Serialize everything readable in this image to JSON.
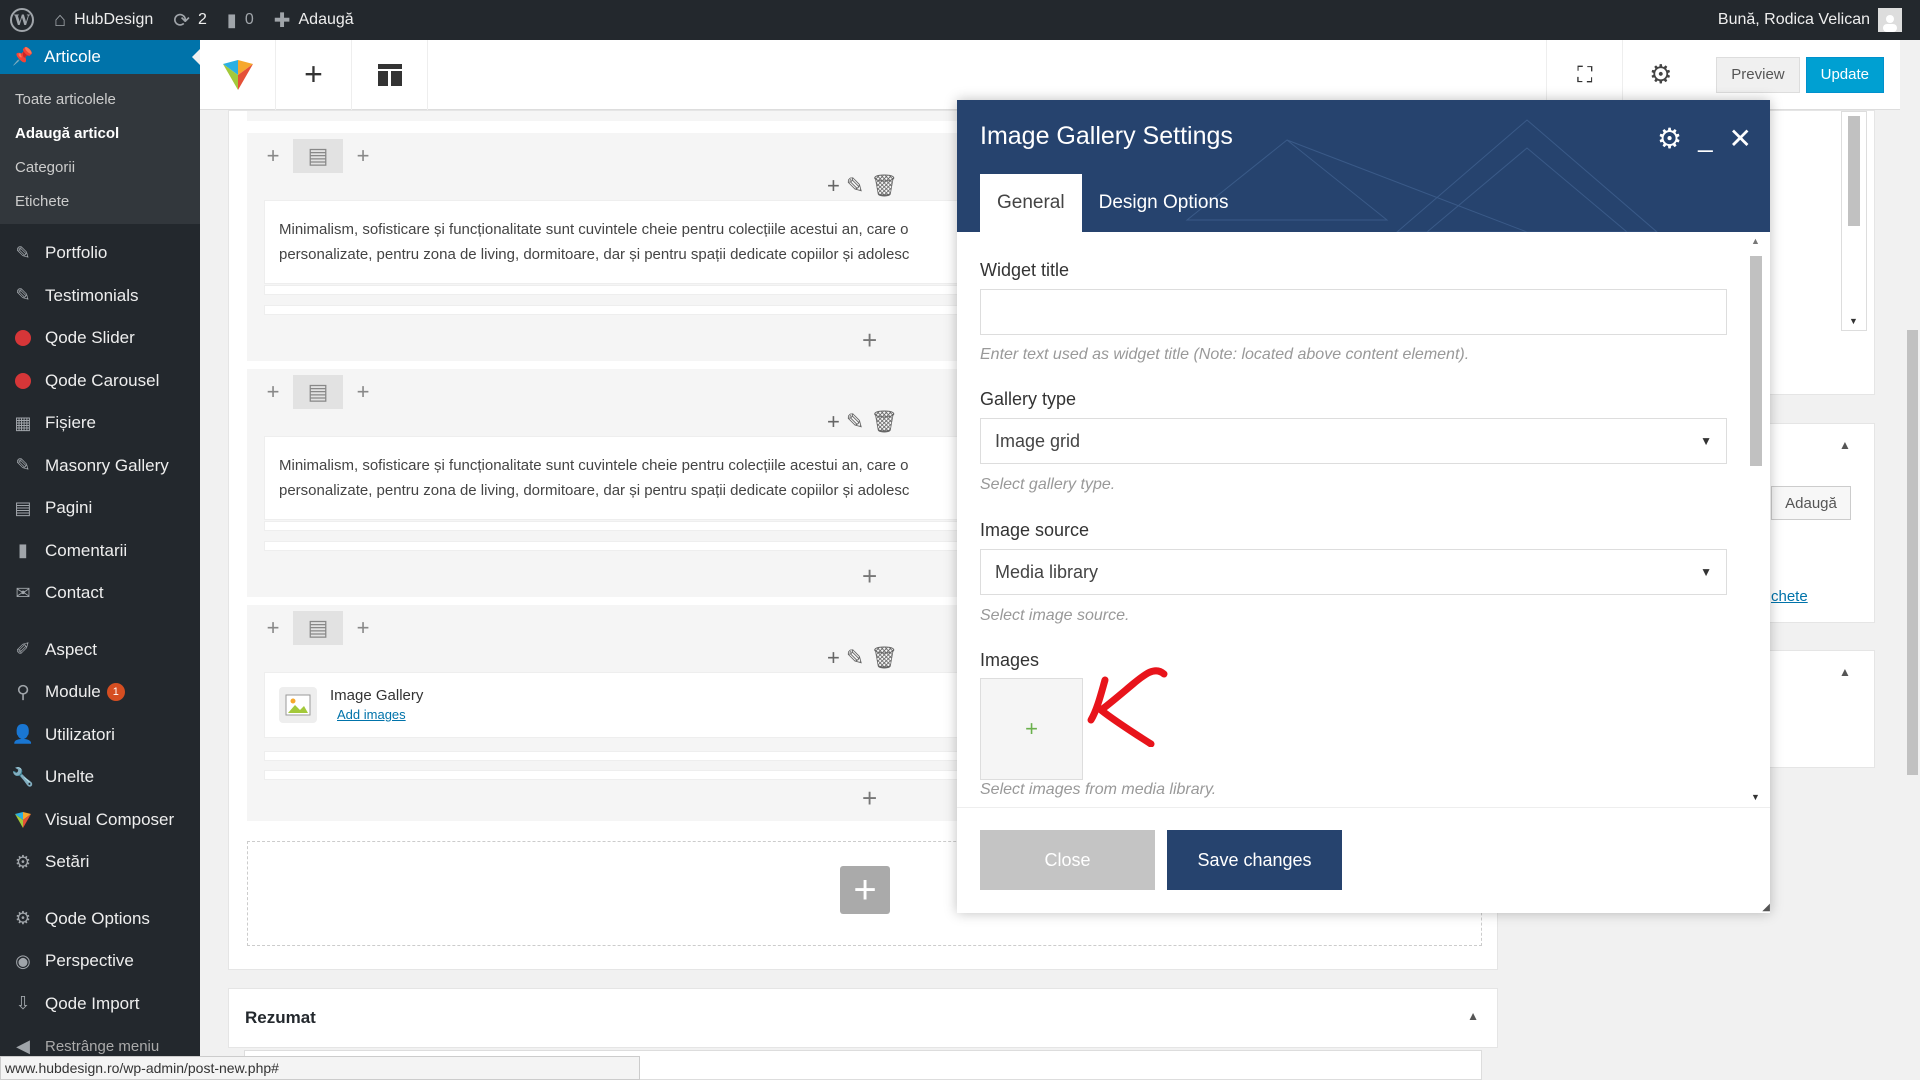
{
  "adminbar": {
    "site_name": "HubDesign",
    "updates_count": "2",
    "comments_count": "0",
    "new_label": "Adaugă",
    "greeting": "Bună, Rodica Velican"
  },
  "sidebar": {
    "current": "Articole",
    "submenu": [
      "Toate articolele",
      "Adaugă articol",
      "Categorii",
      "Etichete"
    ],
    "group1": [
      "Portfolio",
      "Testimonials",
      "Qode Slider",
      "Qode Carousel",
      "Fișiere",
      "Masonry Gallery",
      "Pagini",
      "Comentarii",
      "Contact"
    ],
    "group2": [
      "Aspect",
      "Module",
      "Utilizatori",
      "Unelte",
      "Visual Composer",
      "Setări"
    ],
    "module_badge": "1",
    "group3": [
      "Qode Options",
      "Perspective",
      "Qode Import"
    ],
    "collapse": "Restrânge meniu"
  },
  "toolbar": {
    "preview_label": "Preview",
    "update_label": "Update"
  },
  "editor": {
    "text_line1": "Minimalism, sofisticare și funcționalitate sunt cuvintele cheie pentru colecțiile acestui an, care o",
    "text_line2": "personalizate, pentru zona de living, dormitoare, dar și pentru spații dedicate copiilor și adolesc",
    "gallery_title": "Image Gallery",
    "gallery_link": "Add images"
  },
  "rezumat": {
    "title": "Rezumat"
  },
  "right_panel": {
    "add_button": "Adaugă",
    "tags_link": "chete"
  },
  "modal": {
    "title": "Image Gallery Settings",
    "tabs": [
      "General",
      "Design Options"
    ],
    "widget_title_label": "Widget title",
    "widget_title_value": "",
    "widget_title_help": "Enter text used as widget title (Note: located above content element).",
    "gallery_type_label": "Gallery type",
    "gallery_type_value": "Image grid",
    "gallery_type_help": "Select gallery type.",
    "image_source_label": "Image source",
    "image_source_value": "Media library",
    "image_source_help": "Select image source.",
    "images_label": "Images",
    "images_help": "Select images from media library.",
    "close_label": "Close",
    "save_label": "Save changes"
  },
  "statusbar": {
    "url": "www.hubdesign.ro/wp-admin/post-new.php#"
  },
  "colors": {
    "wp_admin_dark": "#23282d",
    "wp_blue": "#0073aa",
    "modal_header": "#26436e",
    "update_button": "#00a0d2",
    "annotation_red": "#e8141b"
  }
}
